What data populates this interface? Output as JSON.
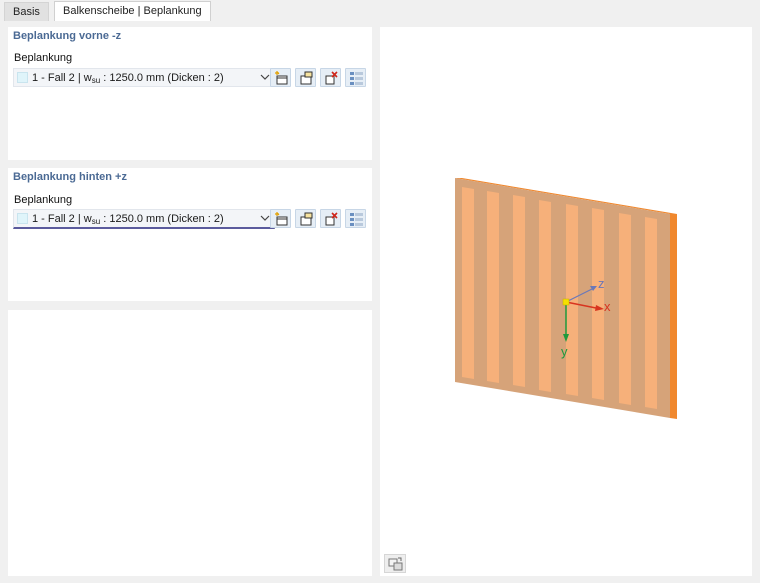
{
  "tabs": [
    {
      "label": "Basis",
      "active": false
    },
    {
      "label": "Balkenscheibe | Beplankung",
      "active": true
    }
  ],
  "front": {
    "title": "Beplankung vorne -z",
    "field_label": "Beplankung",
    "value_prefix": "1 - Fall 2 | w",
    "value_sub": "su",
    "value_suffix": " : 1250.0 mm (Dicken : 2)"
  },
  "back": {
    "title": "Beplankung hinten +z",
    "field_label": "Beplankung",
    "value_prefix": "1 - Fall 2 | w",
    "value_sub": "su",
    "value_suffix": " : 1250.0 mm (Dicken : 2)"
  },
  "axes": {
    "x": "x",
    "y": "y",
    "z": "z"
  },
  "colors": {
    "accent_title": "#4b6a94",
    "panel_face": "#f6b07a",
    "panel_frame": "#d6a379",
    "panel_edge": "#f0882e",
    "axis_x": "#d8341f",
    "axis_y": "#1e9a3c",
    "axis_z": "#6a78b8"
  },
  "icons": [
    "new-icon",
    "copy-icon",
    "delete-icon",
    "list-icon",
    "view-reset-icon",
    "chevron-down-icon"
  ]
}
